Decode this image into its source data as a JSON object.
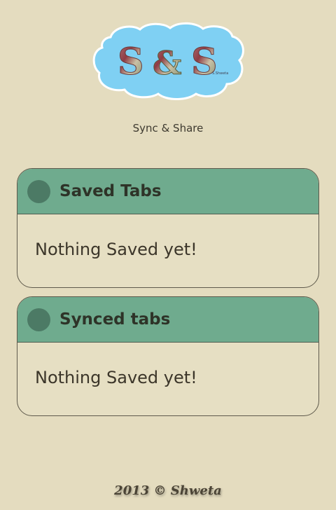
{
  "logo": {
    "letters": "S & S",
    "signature": "S.Shweta",
    "cloud_color": "#7fd0f3"
  },
  "header": {
    "subtitle": "Sync & Share"
  },
  "sections": [
    {
      "title": "Saved Tabs",
      "message": "Nothing Saved yet!"
    },
    {
      "title": "Synced tabs",
      "message": "Nothing Saved yet!"
    }
  ],
  "footer": {
    "credit": "2013 © Shweta"
  },
  "colors": {
    "background": "#e4dcbf",
    "header_green": "#6fab8e",
    "dot_green": "#4c7a65"
  }
}
